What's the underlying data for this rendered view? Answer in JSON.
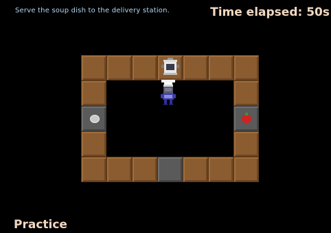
{
  "hud": {
    "instruction": "Serve the soup dish to the delivery station.",
    "timer": "Time elapsed: 50s",
    "mode": "Practice"
  },
  "colors": {
    "counter": "#8b5c30",
    "station": "#5a5a5a",
    "floor": "#000000",
    "instruction_text": "#b7d7f3",
    "hud_text": "#f0d8c0"
  },
  "grid": {
    "cols": 7,
    "rows": 5,
    "layout": [
      [
        "counter",
        "counter",
        "counter",
        "pot-station",
        "counter",
        "counter",
        "counter"
      ],
      [
        "counter",
        "floor",
        "floor",
        "floor",
        "floor",
        "floor",
        "counter"
      ],
      [
        "dish-dispenser",
        "floor",
        "floor",
        "floor",
        "floor",
        "floor",
        "tomato-dispenser"
      ],
      [
        "counter",
        "floor",
        "floor",
        "floor",
        "floor",
        "floor",
        "counter"
      ],
      [
        "counter",
        "counter",
        "counter",
        "serving-station",
        "counter",
        "counter",
        "counter"
      ]
    ]
  },
  "chef": {
    "facing": "up",
    "holding": "dish"
  }
}
